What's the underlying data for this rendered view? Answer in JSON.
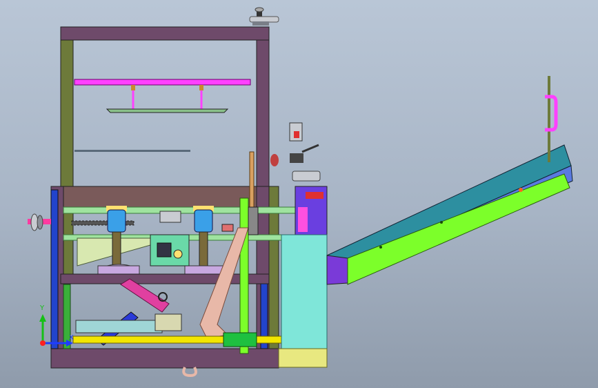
{
  "viewport": {
    "background_top": "#b9c6d6",
    "background_bottom": "#8f9bab"
  },
  "triad": {
    "x_label": "X",
    "y_label": "Y",
    "z_label": "Z",
    "x_color": "#1e3cff",
    "y_color": "#16c016",
    "z_color": "#ff2020"
  },
  "parts": {
    "frame_color": "#6e4a6a",
    "post_color": "#6d7a3a",
    "conveyor_belt_color": "#2d8fa0",
    "conveyor_frame_color": "#7cff2a",
    "cylinder_color": "#3aa0e8",
    "bracket_color": "#d9a0a0",
    "cabinet_color": "#7fe6d9",
    "rail_color": "#ff40ff",
    "yellow_bar_color": "#f2e600"
  }
}
